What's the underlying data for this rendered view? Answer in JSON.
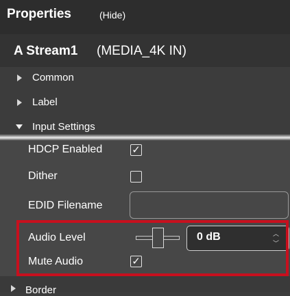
{
  "panel": {
    "title": "Properties",
    "hide_label": "(Hide)"
  },
  "stream": {
    "name_bold": "A Stream1",
    "name_rest": "(MEDIA_4K IN)"
  },
  "sections": {
    "common": "Common",
    "label": "Label",
    "input_settings": "Input Settings",
    "border": "Border"
  },
  "properties": {
    "hdcp_enabled": {
      "label": "HDCP Enabled",
      "checked": true
    },
    "dither": {
      "label": "Dither",
      "checked": false
    },
    "edid_filename": {
      "label": "EDID Filename",
      "value": ""
    },
    "audio_level": {
      "label": "Audio Level",
      "value": "0 dB"
    },
    "mute_audio": {
      "label": "Mute Audio",
      "checked": true
    }
  },
  "glyphs": {
    "check": "✓",
    "spin_up": "︿",
    "spin_down": "﹀"
  },
  "colors": {
    "highlight": "#c8101e",
    "panel_bg": "#3c3c3c",
    "header_bg": "#2d2d2d"
  }
}
